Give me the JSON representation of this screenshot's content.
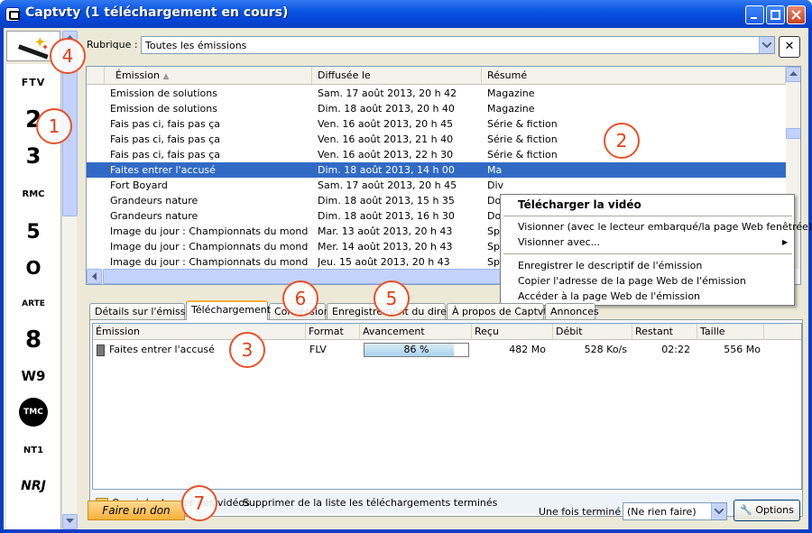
{
  "window": {
    "title": "Captvty (1 téléchargement en cours)"
  },
  "rubrique": {
    "label": "Rubrique :",
    "value": "Toutes les émissions"
  },
  "grid": {
    "headers": [
      "Émission",
      "Diffusée le",
      "Résumé"
    ],
    "rows": [
      {
        "emission": "Emission de solutions",
        "date": "Sam. 17 août 2013, 20 h 42",
        "resume": "Magazine"
      },
      {
        "emission": "Emission de solutions",
        "date": "Dim. 18 août 2013, 20 h 40",
        "resume": "Magazine"
      },
      {
        "emission": "Fais pas ci, fais pas ça",
        "date": "Ven. 16 août 2013, 20 h 45",
        "resume": "Série & fiction"
      },
      {
        "emission": "Fais pas ci, fais pas ça",
        "date": "Ven. 16 août 2013, 21 h 40",
        "resume": "Série & fiction"
      },
      {
        "emission": "Fais pas ci, fais pas ça",
        "date": "Ven. 16 août 2013, 22 h 30",
        "resume": "Série & fiction"
      },
      {
        "emission": "Faites entrer l'accusé",
        "date": "Dim. 18 août 2013, 14 h 00",
        "resume": "Ma"
      },
      {
        "emission": "Fort Boyard",
        "date": "Sam. 17 août 2013, 20 h 45",
        "resume": "Div"
      },
      {
        "emission": "Grandeurs nature",
        "date": "Dim. 18 août 2013, 15 h 35",
        "resume": "Do"
      },
      {
        "emission": "Grandeurs nature",
        "date": "Dim. 18 août 2013, 16 h 30",
        "resume": "Do"
      },
      {
        "emission": "Image du jour : Championnats du monde ...",
        "date": "Mar. 13 août 2013, 20 h 43",
        "resume": "Sp"
      },
      {
        "emission": "Image du jour : Championnats du monde ...",
        "date": "Mer. 14 août 2013, 20 h 43",
        "resume": "Sp"
      },
      {
        "emission": "Image du jour : Championnats du monde ...",
        "date": "Jeu. 15 août 2013, 20 h 43",
        "resume": "Sp"
      }
    ]
  },
  "context_menu": {
    "items": [
      "Télécharger la vidéo",
      "Visionner (avec le lecteur embarqué/la page Web fenêtrée)",
      "Visionner avec...",
      "Enregistrer le descriptif de l'émission",
      "Copier l'adresse de la page Web de l'émission",
      "Accéder à la page Web de l'émission"
    ]
  },
  "tabs": [
    "Détails sur l'émission",
    "Téléchargement",
    "Conversion",
    "Enregistrement du direct",
    "À propos de Captvty",
    "Annonces"
  ],
  "downloads": {
    "headers": [
      "Émission",
      "Format",
      "Avancement",
      "Reçu",
      "Débit",
      "Restant",
      "Taille"
    ],
    "rows": [
      {
        "emission": "Faites entrer l'accusé",
        "format": "FLV",
        "progress_text": "86 %",
        "progress": 0.86,
        "recu": "482 Mo",
        "debit": "528 Ko/s",
        "restant": "02:22",
        "taille": "556 Mo"
      }
    ]
  },
  "footer_links": {
    "open_folder": "Ouvrir le dossier des vidéos",
    "remove_done": "Supprimer de la liste les téléchargements terminés"
  },
  "bottom": {
    "donate": "Faire un don",
    "when_done_label": "Une fois terminé :",
    "when_done_value": "(Ne rien faire)",
    "options": "Options"
  },
  "channels": [
    "FTV",
    "2",
    "3",
    "RMC",
    "5",
    "O",
    "ARTE",
    "8",
    "W9",
    "TMC",
    "NT1",
    "NRJ"
  ],
  "annotations": [
    "1",
    "2",
    "3",
    "4",
    "5",
    "6",
    "7"
  ],
  "colors": {
    "selection": "#316ac5",
    "annotation": "#e8512a",
    "title_bar": "#0a54e2"
  }
}
